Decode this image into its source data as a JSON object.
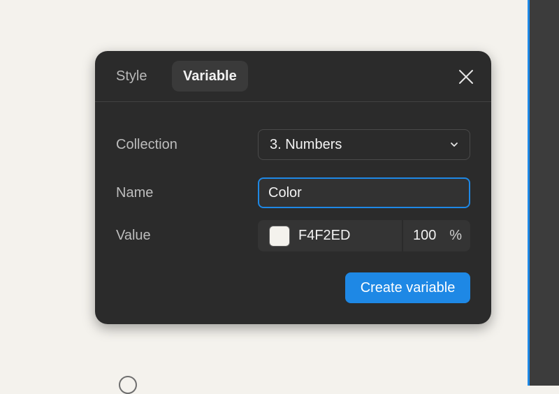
{
  "dialog": {
    "tabs": [
      {
        "label": "Style",
        "active": false
      },
      {
        "label": "Variable",
        "active": true
      }
    ],
    "fields": {
      "collection_label": "Collection",
      "collection_value": "3. Numbers",
      "name_label": "Name",
      "name_value": "Color",
      "value_label": "Value",
      "color_hex": "F4F2ED",
      "opacity": "100",
      "opacity_unit": "%"
    },
    "create_button_label": "Create variable"
  },
  "icons": {
    "close": "close-icon",
    "chevron": "chevron-down-icon",
    "swatch": "color-swatch"
  },
  "colors": {
    "swatch_fill": "#F4F2ED",
    "accent": "#1E88E5",
    "dialog_bg": "#2B2B2B"
  }
}
